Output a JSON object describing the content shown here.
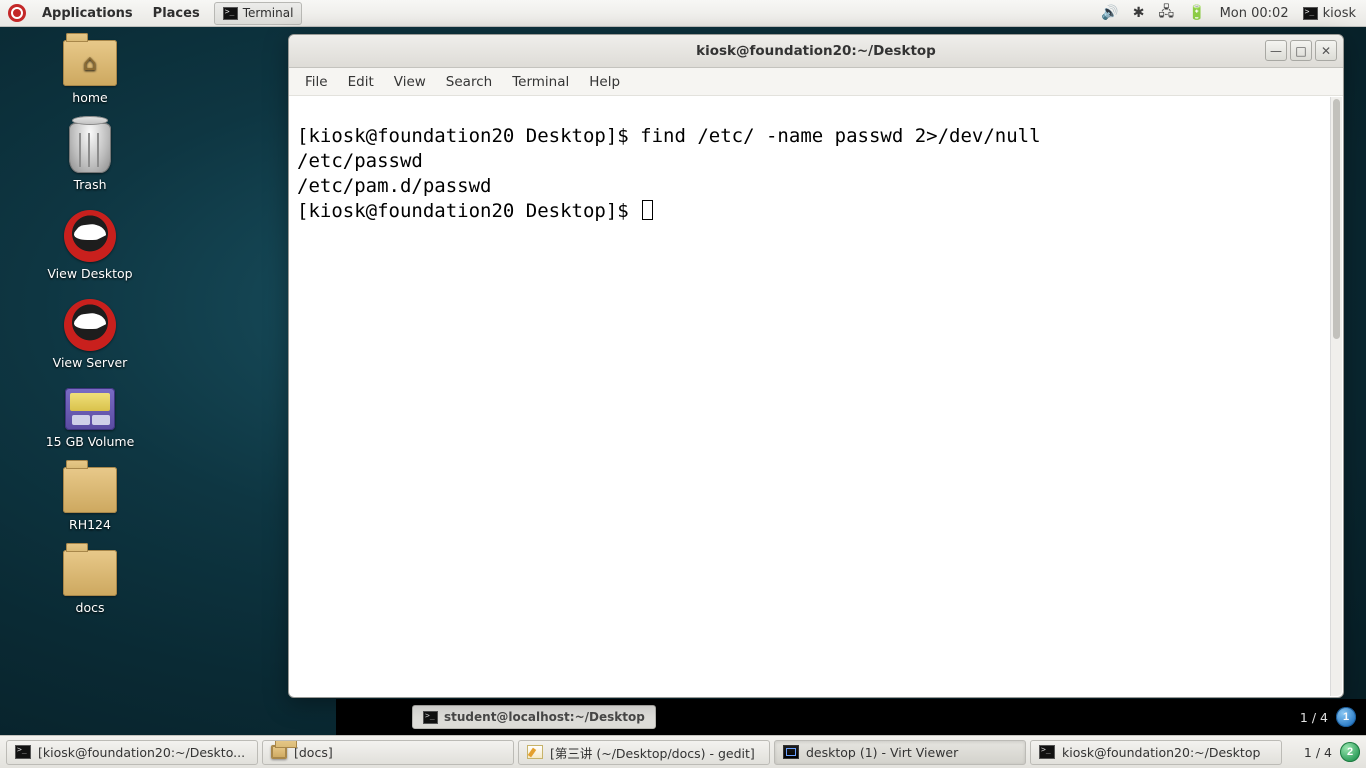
{
  "top_panel": {
    "applications": "Applications",
    "places": "Places",
    "running_task": "Terminal",
    "clock": "Mon 00:02",
    "user": "kiosk"
  },
  "desktop_icons": {
    "home": "home",
    "trash": "Trash",
    "view_desktop": "View Desktop",
    "view_server": "View Server",
    "volume": "15 GB Volume",
    "rh124": "RH124",
    "docs": "docs"
  },
  "terminal_window": {
    "title": "kiosk@foundation20:~/Desktop",
    "menus": {
      "file": "File",
      "edit": "Edit",
      "view": "View",
      "search": "Search",
      "terminal": "Terminal",
      "help": "Help"
    },
    "lines": {
      "l1": "[kiosk@foundation20 Desktop]$ find /etc/ -name passwd 2>/dev/null",
      "l2": "/etc/passwd",
      "l3": "/etc/pam.d/passwd",
      "l4": "[kiosk@foundation20 Desktop]$ "
    },
    "buttons": {
      "min": "—",
      "max": "□",
      "close": "✕"
    }
  },
  "vm_bottom": {
    "task": "student@localhost:~/Desktop",
    "workspace": "1 / 4",
    "badge": "1"
  },
  "host_bar": {
    "t1": "[kiosk@foundation20:~/Deskto...",
    "t2": "[docs]",
    "t3": "[第三讲 (~/Desktop/docs) - gedit]",
    "t4": "desktop (1) - Virt Viewer",
    "t5": "kiosk@foundation20:~/Desktop",
    "workspace": "1 / 4",
    "badge": "2"
  }
}
